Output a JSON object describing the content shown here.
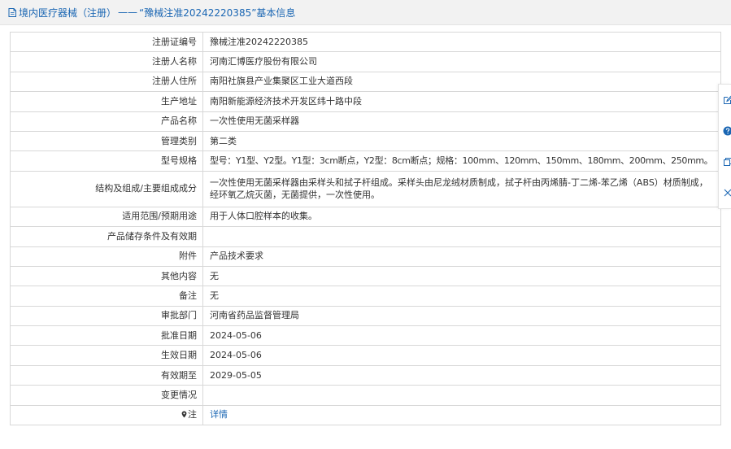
{
  "header": {
    "category": "境内医疗器械（注册）",
    "separator": "——",
    "title": "“豫械注准20242220385”基本信息"
  },
  "rows": [
    {
      "label": "注册证编号",
      "value": "豫械注准20242220385"
    },
    {
      "label": "注册人名称",
      "value": "河南汇博医疗股份有限公司"
    },
    {
      "label": "注册人住所",
      "value": "南阳社旗县产业集聚区工业大道西段"
    },
    {
      "label": "生产地址",
      "value": "南阳新能源经济技术开发区纬十路中段"
    },
    {
      "label": "产品名称",
      "value": "一次性使用无菌采样器"
    },
    {
      "label": "管理类别",
      "value": "第二类"
    },
    {
      "label": "型号规格",
      "value": "型号：Y1型、Y2型。Y1型：3cm断点，Y2型：8cm断点；规格：100mm、120mm、150mm、180mm、200mm、250mm。"
    },
    {
      "label": "结构及组成/主要组成成分",
      "value": "一次性使用无菌采样器由采样头和拭子杆组成。采样头由尼龙绒材质制成，拭子杆由丙烯腈-丁二烯-苯乙烯（ABS）材质制成，经环氧乙烷灭菌，无菌提供，一次性使用。"
    },
    {
      "label": "适用范围/预期用途",
      "value": "用于人体口腔样本的收集。"
    },
    {
      "label": "产品储存条件及有效期",
      "value": ""
    },
    {
      "label": "附件",
      "value": "产品技术要求"
    },
    {
      "label": "其他内容",
      "value": "无"
    },
    {
      "label": "备注",
      "value": "无"
    },
    {
      "label": "审批部门",
      "value": "河南省药品监督管理局"
    },
    {
      "label": "批准日期",
      "value": "2024-05-06"
    },
    {
      "label": "生效日期",
      "value": "2024-05-06"
    },
    {
      "label": "有效期至",
      "value": "2029-05-05"
    },
    {
      "label": "变更情况",
      "value": ""
    },
    {
      "label": "注",
      "value": "详情"
    }
  ],
  "colors": {
    "link": "#1a66b3",
    "header_bg": "#f2f2f2",
    "border": "#d8d8d8"
  },
  "icons": {
    "header": "document-icon",
    "note": "map-pin-icon",
    "side": [
      "edit-icon",
      "help-icon",
      "copy-icon",
      "close-icon"
    ]
  }
}
